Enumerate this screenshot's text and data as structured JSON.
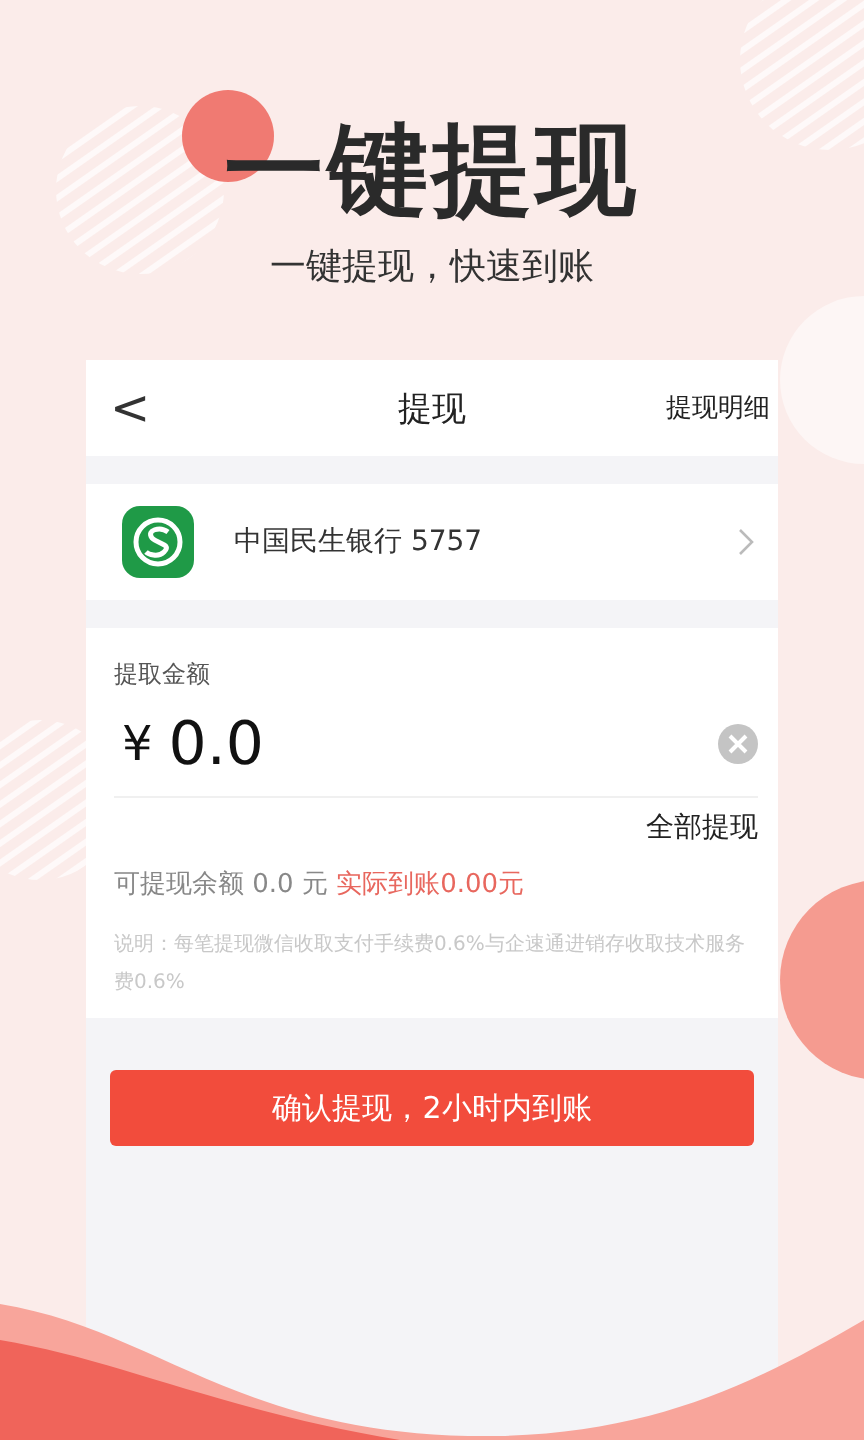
{
  "headline": "一键提现",
  "subheadline": "一键提现，快速到账",
  "nav": {
    "back": "<",
    "title": "提现",
    "action": "提现明细"
  },
  "bank": {
    "name": "中国民生银行 5757"
  },
  "amount": {
    "label": "提取金额",
    "currency": "¥",
    "value": "0.0",
    "withdraw_all": "全部提现"
  },
  "balance": {
    "text": "可提现余额 0.0 元",
    "actual": "实际到账0.00元"
  },
  "note": "说明：每笔提现微信收取支付手续费0.6%与企速通进销存收取技术服务费0.6%",
  "confirm_button": "确认提现，2小时内到账"
}
